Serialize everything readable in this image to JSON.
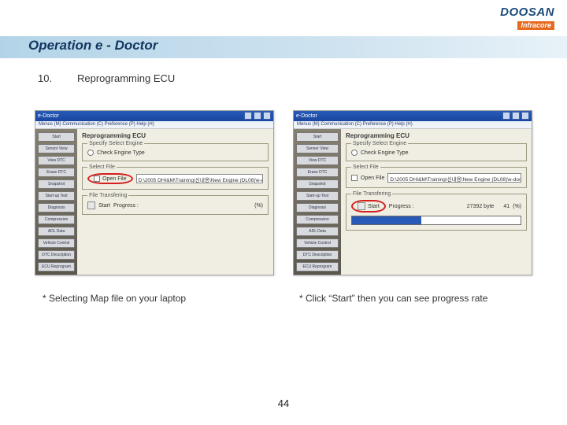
{
  "logo": {
    "brand": "DOOSAN",
    "sub": "Infracore"
  },
  "title": "Operation e - Doctor",
  "section": {
    "num": "10.",
    "label": "Reprogramming ECU"
  },
  "captions": {
    "left": "* Selecting Map file on your laptop",
    "right": "* Click “Start”  then you can see progress rate"
  },
  "page_number": "44",
  "app": {
    "window_title": "e-Doctor",
    "menubar": "Menus (M)   Communication (C)   Preference (P)   Help (H)",
    "sidebar_items": [
      "Start",
      "Sensor View",
      "View DTC",
      "Erase DTC",
      "Snapshot",
      "Start-up Test",
      "Diagnosis",
      "Compression",
      "ADL Data",
      "Vehicle Control",
      "DTC Description",
      "ECU Reprogram"
    ],
    "panel_title": "Reprogramming ECU",
    "group1": {
      "legend": "Specify Select Engine",
      "radio": "Check Engine Type"
    },
    "group2": {
      "legend": "Select File",
      "open_label": "Open File",
      "path": "D:\\2005 DHI&M\\Training\\신내용\\New Engine (DL08)\\e-doct"
    },
    "group3": {
      "legend": "File Transfering",
      "start_label": "Start",
      "progress_label": "Progress :",
      "pct_unit": "(%)",
      "bytes": "27392 byte",
      "pct_value": "41"
    }
  }
}
